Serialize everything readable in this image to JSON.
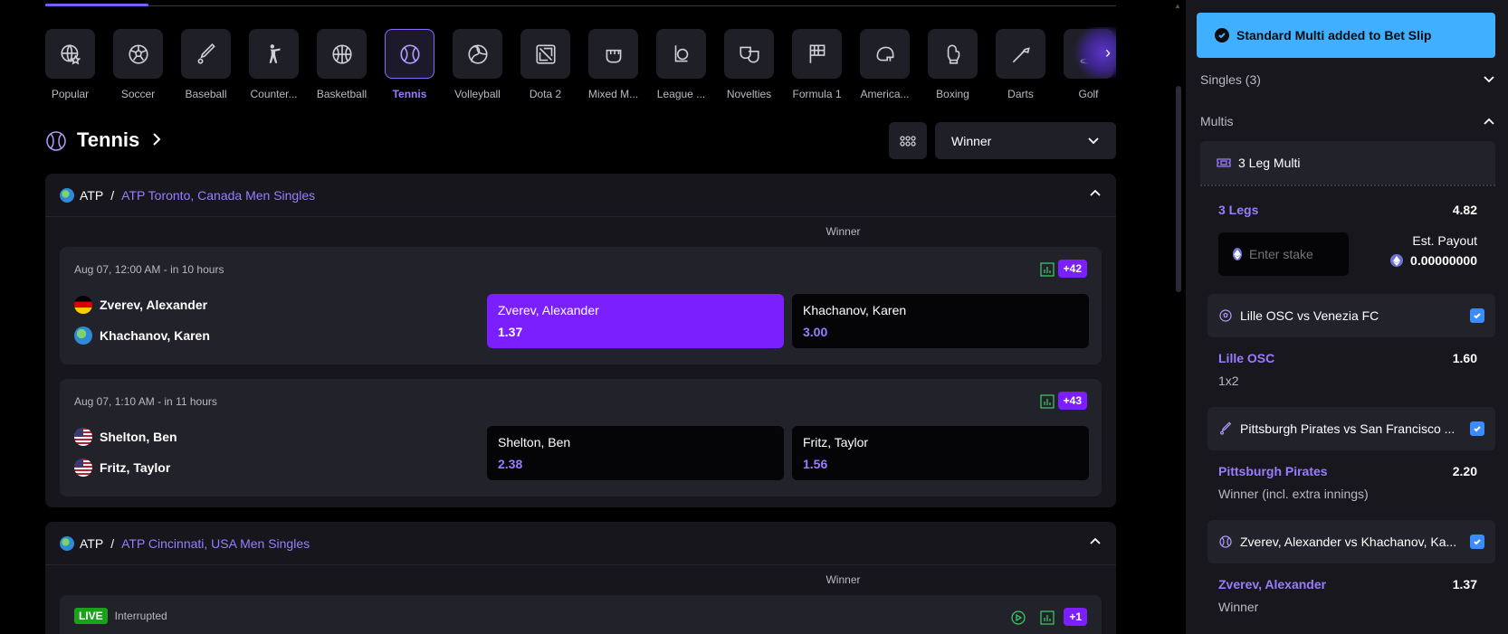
{
  "colors": {
    "accent": "#7b1fff",
    "accent_text": "#9a7dff",
    "toast_bg": "#3fb0ff",
    "live": "#1aa31a",
    "bg": "#000000",
    "panel": "#16161c"
  },
  "sports": [
    {
      "label": "Popular",
      "icon": "globe-star-icon"
    },
    {
      "label": "Soccer",
      "icon": "soccer-ball-icon"
    },
    {
      "label": "Baseball",
      "icon": "baseball-bat-icon"
    },
    {
      "label": "Counter...",
      "icon": "soldier-icon"
    },
    {
      "label": "Basketball",
      "icon": "basketball-icon"
    },
    {
      "label": "Tennis",
      "icon": "tennis-ball-icon",
      "active": true
    },
    {
      "label": "Volleyball",
      "icon": "volleyball-icon"
    },
    {
      "label": "Dota 2",
      "icon": "dota-icon"
    },
    {
      "label": "Mixed M...",
      "icon": "fist-icon"
    },
    {
      "label": "League ...",
      "icon": "league-icon"
    },
    {
      "label": "Novelties",
      "icon": "masks-icon"
    },
    {
      "label": "Formula 1",
      "icon": "checkered-flag-icon"
    },
    {
      "label": "America...",
      "icon": "football-helmet-icon"
    },
    {
      "label": "Boxing",
      "icon": "boxing-glove-icon"
    },
    {
      "label": "Darts",
      "icon": "dart-icon"
    },
    {
      "label": "Golf",
      "icon": "golf-flag-icon"
    }
  ],
  "page": {
    "title": "Tennis",
    "market": "Winner"
  },
  "sections": [
    {
      "category": "ATP",
      "competition": "ATP Toronto, Canada Men Singles",
      "column_label": "Winner",
      "matches": [
        {
          "time": "Aug 07, 12:00 AM - in 10 hours",
          "more": "+42",
          "team1": "Zverev, Alexander",
          "team2": "Khachanov, Karen",
          "odd1": "1.37",
          "odd2": "3.00"
        },
        {
          "time": "Aug 07, 1:10 AM - in 11 hours",
          "more": "+43",
          "team1": "Shelton, Ben",
          "team2": "Fritz, Taylor",
          "odd1": "2.38",
          "odd2": "1.56"
        }
      ]
    },
    {
      "category": "ATP",
      "competition": "ATP Cincinnati, USA Men Singles",
      "column_label": "Winner",
      "live_badge": "LIVE",
      "status": "Interrupted",
      "more": "+1"
    }
  ],
  "slip": {
    "toast": "Standard Multi added to Bet Slip",
    "singles": "Singles (3)",
    "multis": "Multis",
    "multi_title": "3 Leg Multi",
    "legs_label": "3 Legs",
    "legs_odds": "4.82",
    "stake_placeholder": "Enter stake",
    "payout_label": "Est. Payout",
    "payout_value": "0.00000000",
    "legs": [
      {
        "event": "Lille OSC vs Venezia FC",
        "selection": "Lille OSC",
        "odds": "1.60",
        "market": "1x2",
        "icon": "soccer-ball-icon"
      },
      {
        "event": "Pittsburgh Pirates vs San Francisco ...",
        "selection": "Pittsburgh Pirates",
        "odds": "2.20",
        "market": "Winner (incl. extra innings)",
        "icon": "baseball-bat-icon"
      },
      {
        "event": "Zverev, Alexander vs Khachanov, Ka...",
        "selection": "Zverev, Alexander",
        "odds": "1.37",
        "market": "Winner",
        "icon": "tennis-ball-icon"
      }
    ]
  }
}
